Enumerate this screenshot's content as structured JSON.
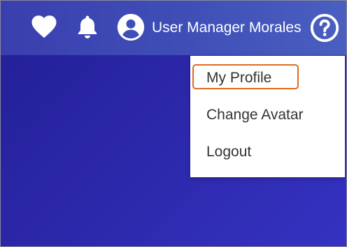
{
  "header": {
    "favorites_icon": "heart-icon",
    "notifications_icon": "bell-icon",
    "account_icon": "user-circle-icon",
    "user_name": "User Manager Morales",
    "help_icon": "question-circle-icon"
  },
  "user_menu": {
    "items": [
      {
        "label": "My Profile",
        "highlighted": true
      },
      {
        "label": "Change Avatar",
        "highlighted": false
      },
      {
        "label": "Logout",
        "highlighted": false
      }
    ]
  },
  "colors": {
    "header_bg": "#3f4fb7",
    "page_bg": "#2b27a8",
    "highlight_border": "#e36a1f",
    "menu_text": "#333333"
  }
}
